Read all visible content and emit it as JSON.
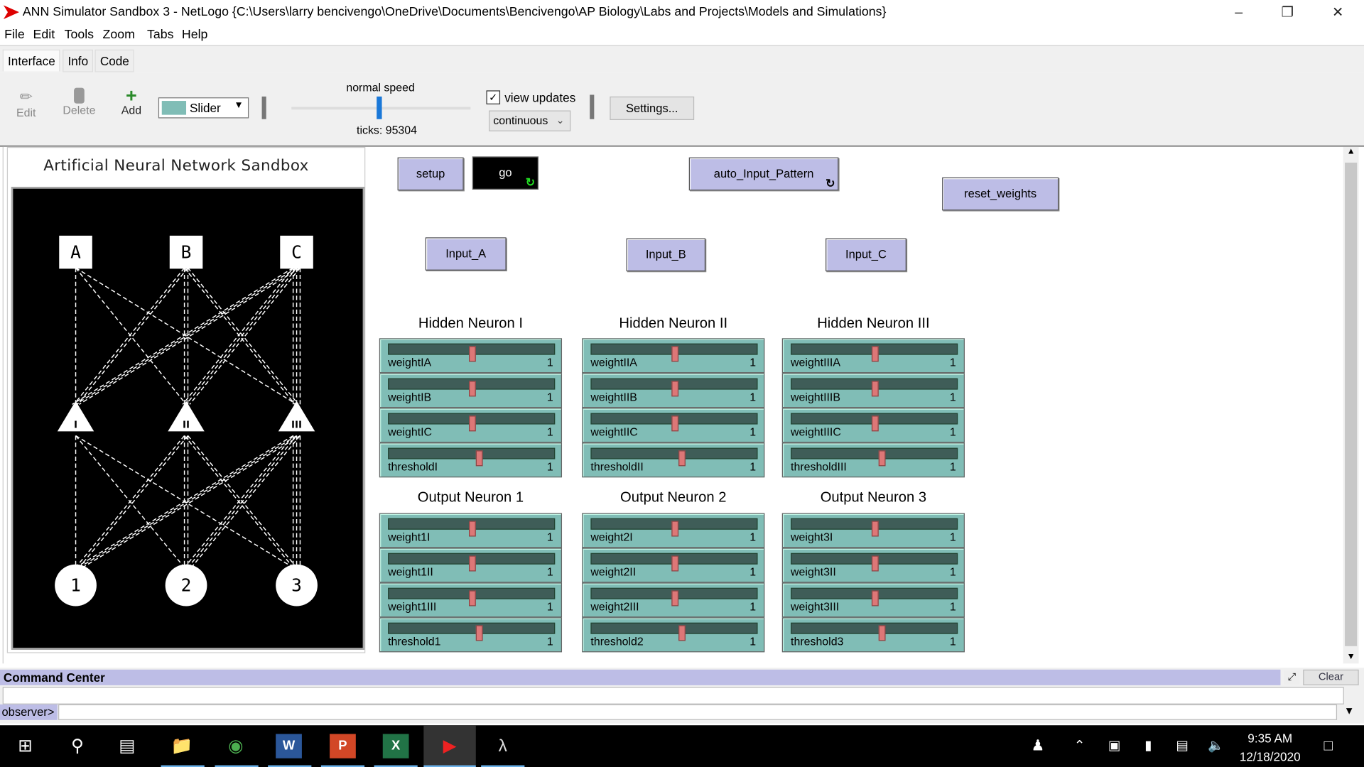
{
  "window": {
    "title": "ANN Simulator Sandbox 3 - NetLogo {C:\\Users\\larry bencivengo\\OneDrive\\Documents\\Bencivengo\\AP Biology\\Labs and Projects\\Models and Simulations}",
    "accent": "#cc0000"
  },
  "menu": [
    "File",
    "Edit",
    "Tools",
    "Zoom",
    "Tabs",
    "Help"
  ],
  "tabs": [
    "Interface",
    "Info",
    "Code"
  ],
  "toolbar": {
    "edit": "Edit",
    "delete": "Delete",
    "add": "Add",
    "widget_type": "Slider",
    "speed_label": "normal speed",
    "ticks": "ticks: 95304",
    "view_updates": "view updates",
    "view_updates_checked": true,
    "update_mode": "continuous",
    "settings": "Settings..."
  },
  "view": {
    "title": "Artificial Neural Network Sandbox",
    "inputs": [
      "A",
      "B",
      "C"
    ],
    "hidden": [
      "I",
      "II",
      "III"
    ],
    "outputs": [
      "1",
      "2",
      "3"
    ]
  },
  "buttons": {
    "setup": "setup",
    "go": "go",
    "auto": "auto_Input_Pattern",
    "reset": "reset_weights",
    "input_a": "Input_A",
    "input_b": "Input_B",
    "input_c": "Input_C"
  },
  "groups": [
    {
      "title": "Hidden Neuron I",
      "sliders": [
        {
          "name": "weightIA",
          "value": "1"
        },
        {
          "name": "weightIB",
          "value": "1"
        },
        {
          "name": "weightIC",
          "value": "1"
        },
        {
          "name": "thresholdI",
          "value": "1"
        }
      ]
    },
    {
      "title": "Hidden Neuron II",
      "sliders": [
        {
          "name": "weightIIA",
          "value": "1"
        },
        {
          "name": "weightIIB",
          "value": "1"
        },
        {
          "name": "weightIIC",
          "value": "1"
        },
        {
          "name": "thresholdII",
          "value": "1"
        }
      ]
    },
    {
      "title": "Hidden Neuron III",
      "sliders": [
        {
          "name": "weightIIIA",
          "value": "1"
        },
        {
          "name": "weightIIIB",
          "value": "1"
        },
        {
          "name": "weightIIIC",
          "value": "1"
        },
        {
          "name": "thresholdIII",
          "value": "1"
        }
      ]
    },
    {
      "title": "Output Neuron 1",
      "sliders": [
        {
          "name": "weight1I",
          "value": "1"
        },
        {
          "name": "weight1II",
          "value": "1"
        },
        {
          "name": "weight1III",
          "value": "1"
        },
        {
          "name": "threshold1",
          "value": "1"
        }
      ]
    },
    {
      "title": "Output Neuron 2",
      "sliders": [
        {
          "name": "weight2I",
          "value": "1"
        },
        {
          "name": "weight2II",
          "value": "1"
        },
        {
          "name": "weight2III",
          "value": "1"
        },
        {
          "name": "threshold2",
          "value": "1"
        }
      ]
    },
    {
      "title": "Output Neuron 3",
      "sliders": [
        {
          "name": "weight3I",
          "value": "1"
        },
        {
          "name": "weight3II",
          "value": "1"
        },
        {
          "name": "weight3III",
          "value": "1"
        },
        {
          "name": "threshold3",
          "value": "1"
        }
      ]
    }
  ],
  "command_center": {
    "title": "Command Center",
    "clear": "Clear",
    "prompt": "observer>",
    "input": ""
  },
  "taskbar": {
    "time": "9:35 AM",
    "date": "12/18/2020"
  }
}
